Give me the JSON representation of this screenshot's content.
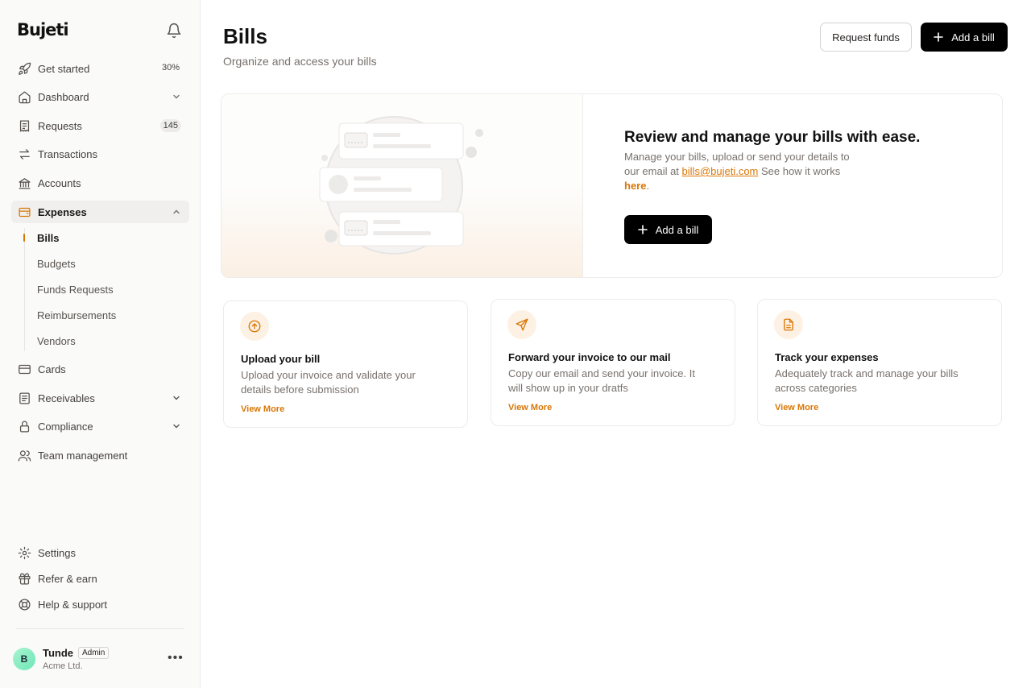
{
  "brand": {
    "logo": "Bujeti"
  },
  "sidebar": {
    "items": [
      {
        "label": "Get started",
        "progress": "30%"
      },
      {
        "label": "Dashboard"
      },
      {
        "label": "Requests",
        "badge": "145"
      },
      {
        "label": "Transactions"
      },
      {
        "label": "Accounts"
      },
      {
        "label": "Expenses"
      },
      {
        "label": "Cards"
      },
      {
        "label": "Receivables"
      },
      {
        "label": "Compliance"
      },
      {
        "label": "Team management"
      }
    ],
    "expenses_sub": [
      {
        "label": "Bills"
      },
      {
        "label": "Budgets"
      },
      {
        "label": "Funds Requests"
      },
      {
        "label": "Reimbursements"
      },
      {
        "label": "Vendors"
      }
    ],
    "bottom": [
      {
        "label": "Settings"
      },
      {
        "label": "Refer & earn"
      },
      {
        "label": "Help & support"
      }
    ],
    "user": {
      "initial": "B",
      "name": "Tunde",
      "role": "Admin",
      "company": "Acme Ltd."
    }
  },
  "header": {
    "title": "Bills",
    "subtitle": "Organize and access your bills",
    "request_label": "Request funds",
    "add_label": "Add a bill"
  },
  "hero": {
    "title": "Review and manage your bills with ease.",
    "text_before": "Manage your bills, upload or send your details to our email at ",
    "email": "bills@bujeti.com",
    "text_after": " See how it works ",
    "here": "here",
    "period": ".",
    "button_label": "Add a bill"
  },
  "cards": [
    {
      "title": "Upload your bill",
      "text": "Upload your invoice and validate your details before submission",
      "link": "View More"
    },
    {
      "title": "Forward your invoice to our mail",
      "text": "Copy our email and send your invoice. It will show up in your dratfs",
      "link": "View More"
    },
    {
      "title": "Track your expenses",
      "text": "Adequately track and manage your bills across categories",
      "link": "View More"
    }
  ],
  "colors": {
    "accent": "#d97706",
    "primary_button": "#000000",
    "sidebar_bg": "#fafaf9"
  }
}
